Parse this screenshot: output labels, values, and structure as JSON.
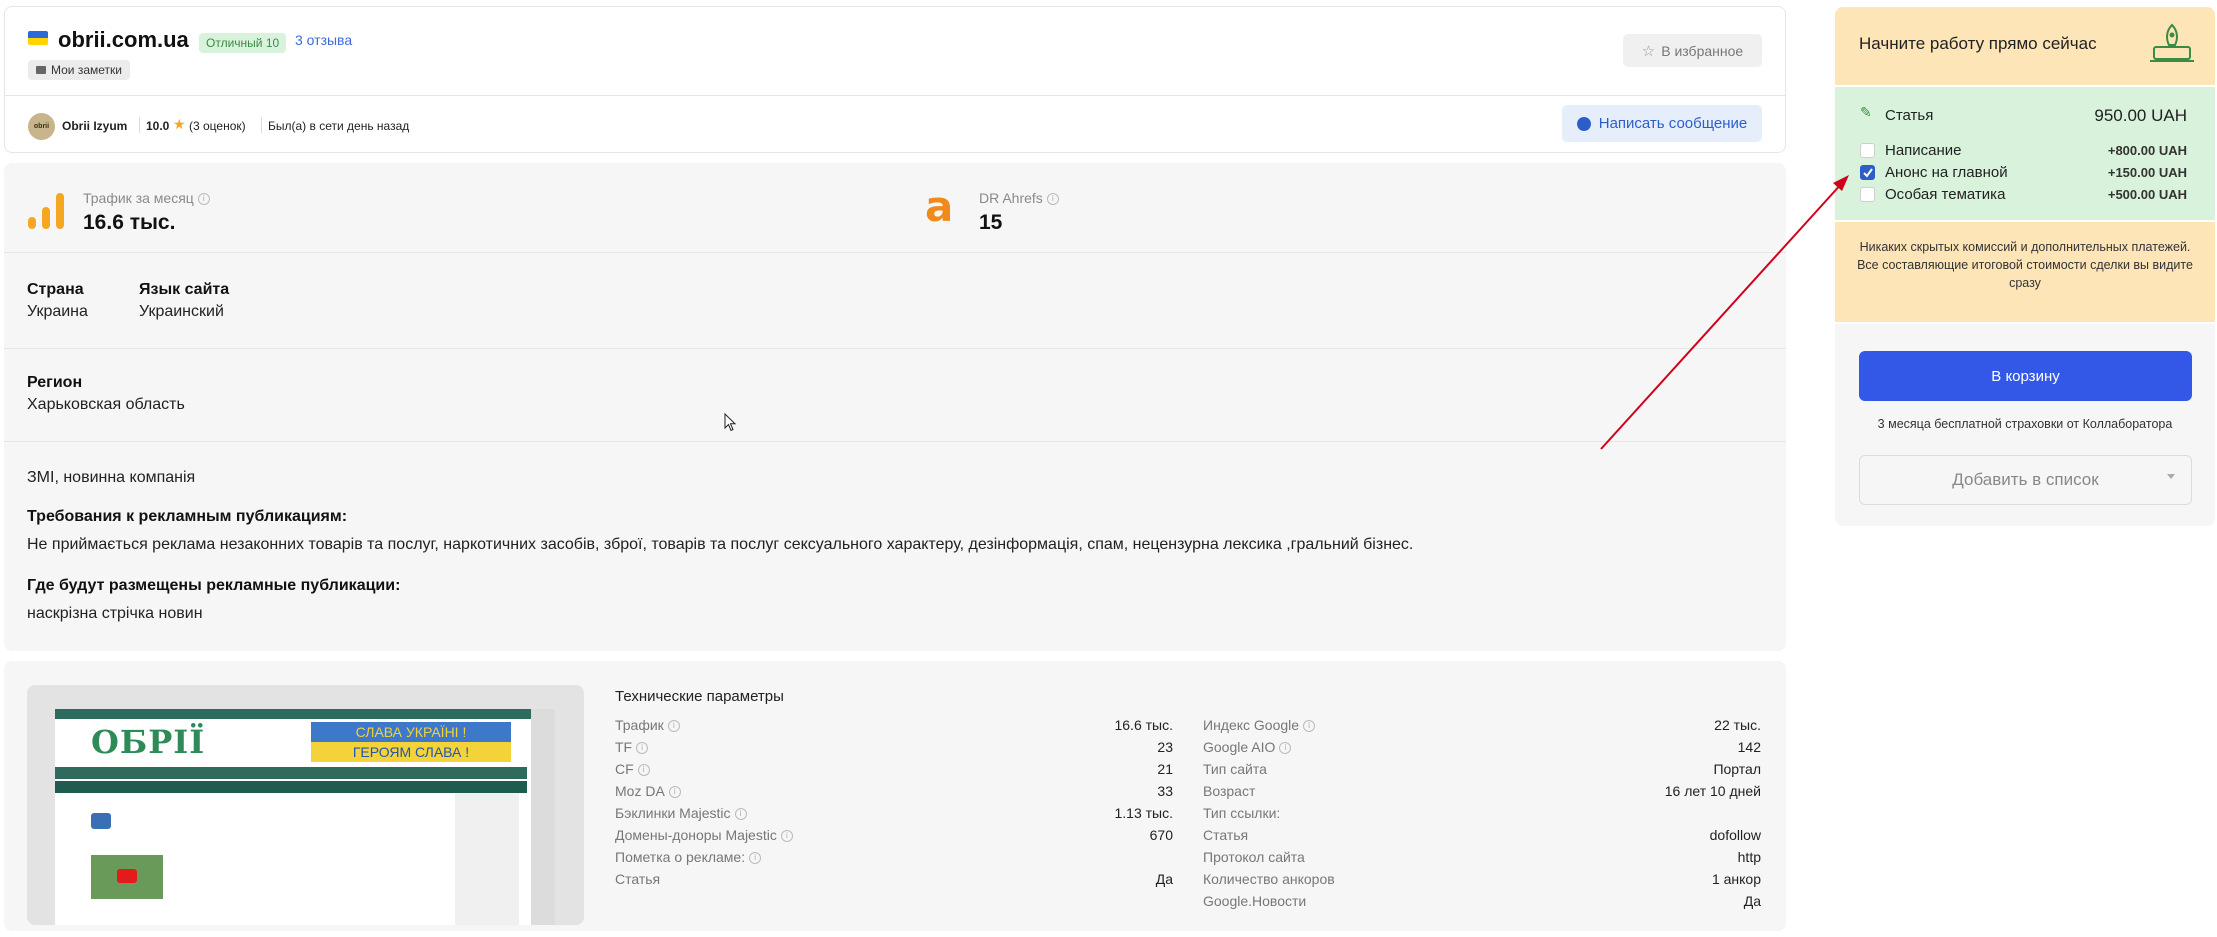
{
  "header": {
    "site": "obrii.com.ua",
    "rating_badge": "Отличный 10",
    "reviews_link": "3 отзыва",
    "notes_label": "Мои заметки",
    "favorite_button": "В избранное",
    "owner_name": "Obrii Izyum",
    "owner_rating": "10.0",
    "owner_reviews": "(3 оценок)",
    "owner_status": "Был(а) в сети день назад",
    "message_button": "Написать сообщение",
    "avatar_text": "obrii"
  },
  "metrics": {
    "traffic_label": "Трафик за месяц",
    "traffic_value": "16.6 тыс.",
    "dr_label": "DR Ahrefs",
    "dr_value": "15"
  },
  "details": {
    "country_label": "Страна",
    "country_value": "Украина",
    "language_label": "Язык сайта",
    "language_value": "Украинский",
    "region_label": "Регион",
    "region_value": "Харьковская область",
    "description": "ЗМІ, новинна компанія",
    "requirements_label": "Требования к рекламным публикациям:",
    "requirements_value": "Не приймається реклама незаконних товарів та послуг, наркотичних засобів, зброї, товарів та послуг сексуального характеру, дезінформація, спам, нецензурна лексика ,гральний бізнес.",
    "placement_label": "Где будут размещены рекламные публикации:",
    "placement_value": "наскрізна стрічка новин"
  },
  "tech": {
    "title": "Технические параметры",
    "left": [
      {
        "label": "Трафик",
        "value": "16.6 тыс.",
        "info": true
      },
      {
        "label": "TF",
        "value": "23",
        "info": true
      },
      {
        "label": "CF",
        "value": "21",
        "info": true
      },
      {
        "label": "Moz DA",
        "value": "33",
        "info": true
      },
      {
        "label": "Бэклинки Majestic",
        "value": "1.13 тыс.",
        "info": true
      },
      {
        "label": "Домены-доноры Majestic",
        "value": "670",
        "info": true
      },
      {
        "label": "Пометка о рекламе:",
        "value": "",
        "info": true
      },
      {
        "label": "Статья",
        "value": "Да",
        "info": false
      }
    ],
    "right": [
      {
        "label": "Индекс Google",
        "value": "22 тыс.",
        "info": true
      },
      {
        "label": "Google AIO",
        "value": "142",
        "info": true
      },
      {
        "label": "Тип сайта",
        "value": "Портал",
        "info": false
      },
      {
        "label": "Возраст",
        "value": "16 лет 10 дней",
        "info": false
      },
      {
        "label": "Тип ссылки:",
        "value": "",
        "info": false
      },
      {
        "label": "Статья",
        "value": "dofollow",
        "info": false
      },
      {
        "label": "Протокол сайта",
        "value": "http",
        "info": false
      },
      {
        "label": "Количество анкоров",
        "value": "1 анкор",
        "info": false
      },
      {
        "label": "Google.Новости",
        "value": "Да",
        "info": false
      }
    ]
  },
  "thumbnail": {
    "logo": "ОБРІЇ",
    "banner_line1": "СЛАВА УКРАЇНІ !",
    "banner_line2": "ГЕРОЯМ СЛАВА !"
  },
  "order_panel": {
    "title": "Начните работу прямо сейчас",
    "article_label": "Статья",
    "article_price": "950.00 UAH",
    "options": [
      {
        "label": "Написание",
        "price": "+800.00 UAH",
        "checked": false
      },
      {
        "label": "Анонс на главной",
        "price": "+150.00 UAH",
        "checked": true
      },
      {
        "label": "Особая тематика",
        "price": "+500.00 UAH",
        "checked": false
      }
    ],
    "notice": "Никаких скрытых комиссий и дополнительных платежей. Все составляющие итоговой стоимости сделки вы видите сразу",
    "cart_button": "В корзину",
    "insurance_text": "3 месяца бесплатной страховки от Коллаборатора",
    "list_button": "Добавить в список"
  },
  "colors": {
    "accent_blue": "#3358e8",
    "green_bg": "#d9f2dc",
    "orange_bg": "#fde5b8",
    "arrow": "#d0021b",
    "traffic_icon": "#f5a623",
    "ahrefs_icon": "#f08a1c"
  }
}
